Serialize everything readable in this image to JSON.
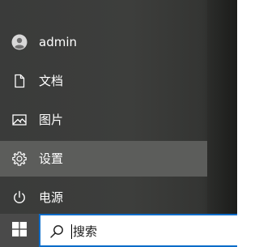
{
  "start_menu": {
    "items": [
      {
        "label": "admin",
        "icon": "user-avatar-icon"
      },
      {
        "label": "文档",
        "icon": "document-icon"
      },
      {
        "label": "图片",
        "icon": "picture-icon"
      },
      {
        "label": "设置",
        "icon": "gear-icon"
      },
      {
        "label": "电源",
        "icon": "power-icon"
      }
    ],
    "highlighted_item": "设置"
  },
  "taskbar": {
    "start_icon": "windows-logo-icon",
    "search": {
      "placeholder": "搜索",
      "icon": "search-icon",
      "accent_color": "#0a6cc9"
    }
  }
}
